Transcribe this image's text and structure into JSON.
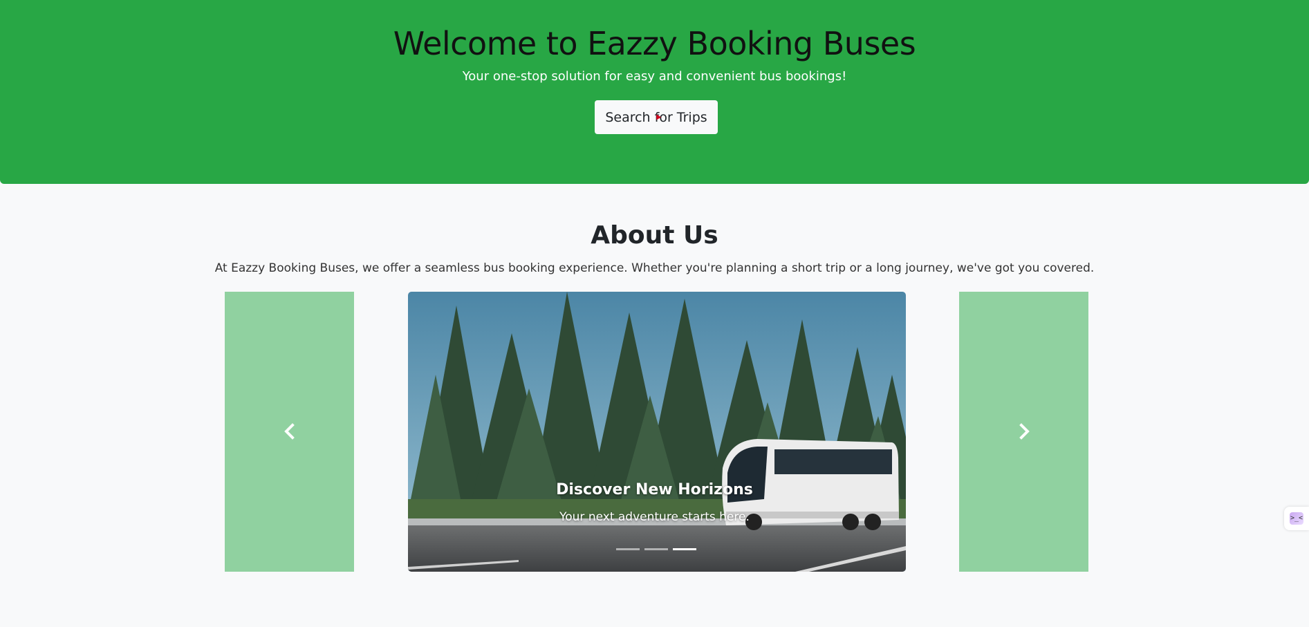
{
  "hero": {
    "title": "Welcome to Eazzy Booking Buses",
    "subtitle": "Your one-stop solution for easy and convenient bus bookings!",
    "search_button_label": "Search for Trips",
    "background_color": "#28a745"
  },
  "about": {
    "heading": "About Us",
    "description": "At Eazzy Booking Buses, we offer a seamless bus booking experience. Whether you're planning a short trip or a long journey, we've got you covered."
  },
  "carousel": {
    "active_slide": 3,
    "slide_count": 3,
    "caption_title": "Discover New Horizons",
    "caption_subtitle": "Your next adventure starts here.",
    "prev_icon": "chevron-left-icon",
    "next_icon": "chevron-right-icon",
    "panel_color": "#90d1a0"
  },
  "floating_widget": {
    "icon": "extension-icon",
    "glyph": ">_<"
  }
}
